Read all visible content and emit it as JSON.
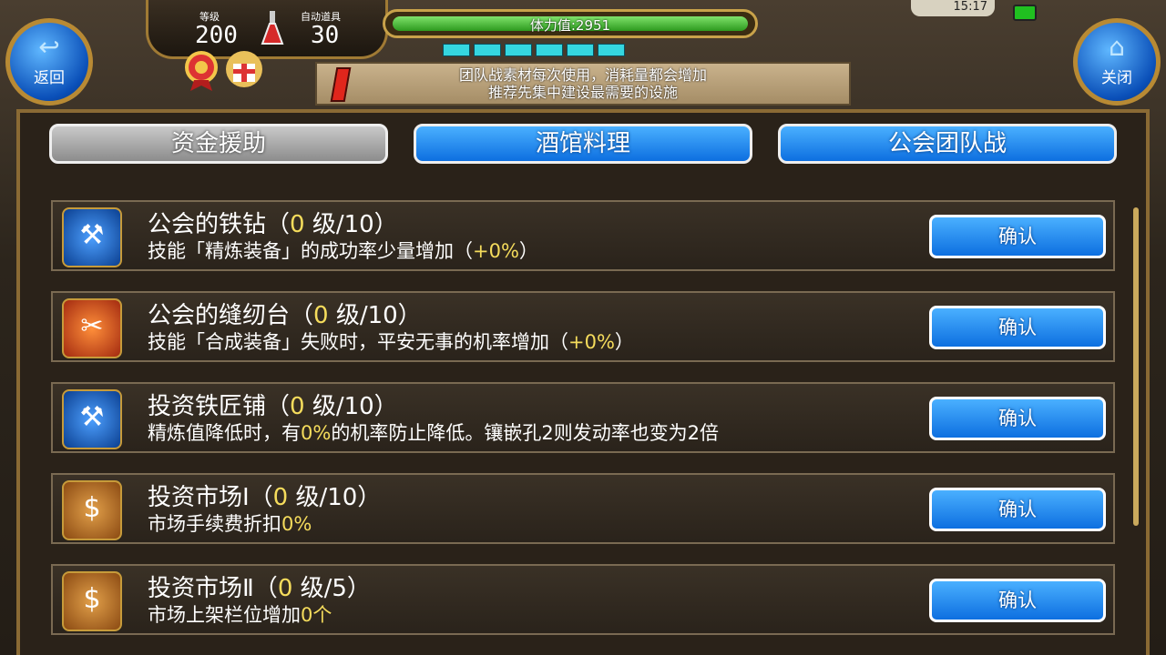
{
  "hud": {
    "level_label": "等级",
    "level_value": "200",
    "auto_label": "自动道具",
    "auto_value": "30",
    "stamina_text": "体力值:2951",
    "stamina_fraction": 1.0,
    "segments": 6,
    "time": "15:17"
  },
  "notice": {
    "line1": "团队战素材每次使用，消耗量都会增加",
    "line2": "推荐先集中建设最需要的设施"
  },
  "nav": {
    "back_label": "返回",
    "close_label": "关闭"
  },
  "tabs": [
    {
      "label": "资金援助",
      "active": true
    },
    {
      "label": "酒馆料理",
      "active": false
    },
    {
      "label": "公会团队战",
      "active": false
    }
  ],
  "items": [
    {
      "icon": "anvil-icon",
      "title_name": "公会的铁钻（",
      "title_lvl": "0",
      "title_rest": " 级/10）",
      "desc_pre": "技能「精炼装备」的成功率少量增加（",
      "desc_hl": "+0%",
      "desc_post": "）",
      "button": "确认"
    },
    {
      "icon": "sewing-table-icon",
      "title_name": "公会的缝纫台（",
      "title_lvl": "0",
      "title_rest": " 级/10）",
      "desc_pre": "技能「合成装备」失败时，平安无事的机率增加（",
      "desc_hl": "+0%",
      "desc_post": "）",
      "button": "确认"
    },
    {
      "icon": "blacksmith-icon",
      "title_name": "投资铁匠铺（",
      "title_lvl": "0",
      "title_rest": " 级/10）",
      "desc_pre": "精炼值降低时，有",
      "desc_hl": "0%",
      "desc_post": "的机率防止降低。镶嵌孔2则发动率也变为2倍",
      "button": "确认"
    },
    {
      "icon": "market-icon",
      "title_name": "投资市场Ⅰ（",
      "title_lvl": "0",
      "title_rest": " 级/10）",
      "desc_pre": "市场手续费折扣",
      "desc_hl": "0%",
      "desc_post": "",
      "button": "确认"
    },
    {
      "icon": "market-icon",
      "title_name": "投资市场Ⅱ（",
      "title_lvl": "0",
      "title_rest": " 级/5）",
      "desc_pre": "市场上架栏位增加",
      "desc_hl": "0个",
      "desc_post": "",
      "button": "确认"
    }
  ]
}
